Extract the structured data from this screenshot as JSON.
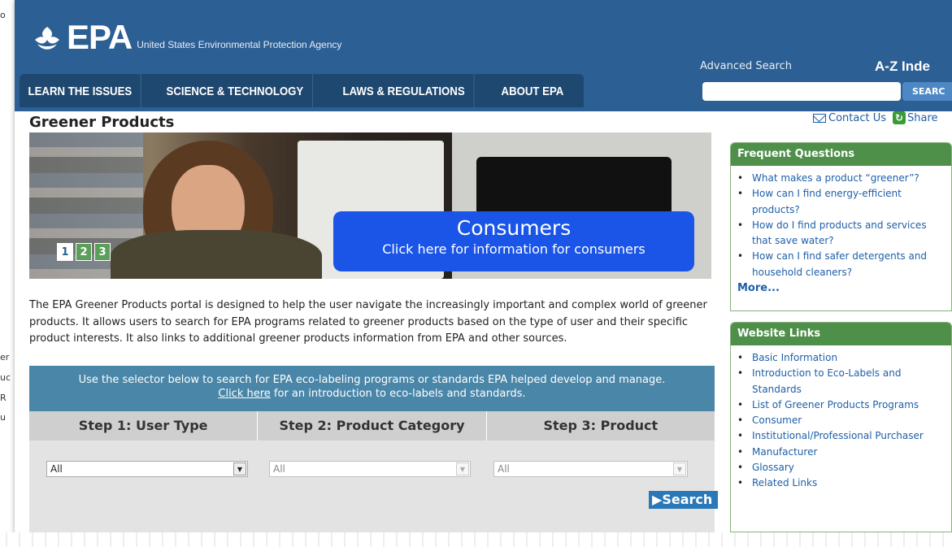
{
  "header": {
    "logo_text": "EPA",
    "agency_name": "United States Environmental Protection Agency",
    "advanced_search": "Advanced Search",
    "az_index": "A-Z Inde",
    "search_button": "SEARC"
  },
  "nav": {
    "items": [
      "LEARN THE ISSUES",
      "SCIENCE & TECHNOLOGY",
      "LAWS & REGULATIONS",
      "ABOUT EPA"
    ]
  },
  "page": {
    "title": "Greener Products",
    "contact_us": "Contact Us",
    "share": "Share"
  },
  "hero": {
    "slides": [
      "1",
      "2",
      "3"
    ],
    "active_slide": "1",
    "title": "Consumers",
    "subtitle": "Click here for information for consumers"
  },
  "intro": {
    "text": "The EPA Greener Products portal is designed to help the user navigate the increasingly important and complex world of greener products. It allows users to search for EPA programs related to greener products based on the type of user and their specific product interests. It also links to additional greener products information from EPA and other sources."
  },
  "selector": {
    "banner_line1": "Use the selector below to search for EPA eco-labeling programs or standards EPA helped develop and manage.",
    "banner_link": "Click here",
    "banner_line2_rest": " for an introduction to eco-labels and standards.",
    "steps": [
      "Step 1: User Type",
      "Step 2: Product Category",
      "Step 3: Product"
    ],
    "select_values": [
      "All",
      "All",
      "All"
    ],
    "search_label": "Search"
  },
  "frequent_questions": {
    "heading": "Frequent Questions",
    "items": [
      "What makes a product “greener”?",
      "How can I find energy-efficient products?",
      "How do I find products and services that save water?",
      "How can I find safer detergents and household cleaners?"
    ],
    "more": "More..."
  },
  "website_links": {
    "heading": "Website Links",
    "items": [
      "Basic Information",
      "Introduction to Eco-Labels and Standards",
      "List of Greener Products Programs",
      "Consumer",
      "Institutional/Professional Purchaser",
      "Manufacturer",
      "Glossary",
      "Related Links"
    ]
  },
  "edge_fragments": [
    "o",
    "er",
    "uc",
    "R",
    "u"
  ],
  "colors": {
    "header_blue": "#2c5f94",
    "nav_dark": "#1f4870",
    "sidebar_green": "#4e8f4a",
    "selector_banner": "#4a86a8",
    "consumer_box": "#1a55e8",
    "link_blue": "#1e5fa8"
  }
}
